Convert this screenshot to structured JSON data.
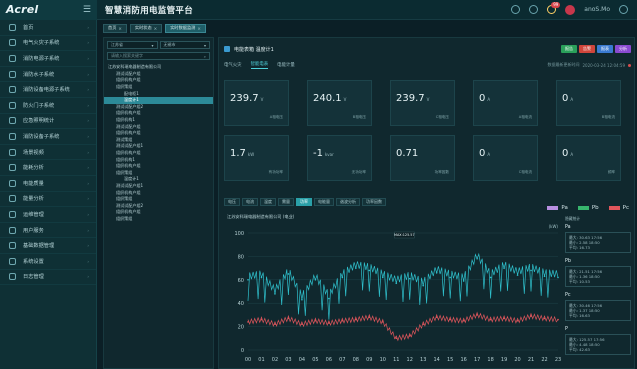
{
  "header": {
    "logo": "Acrel",
    "title": "智慧消防用电监管平台",
    "top_right_badge": "99",
    "user": "anoS.Mo"
  },
  "sidebar": {
    "items": [
      {
        "label": "首页"
      },
      {
        "label": "电气火灾子系统"
      },
      {
        "label": "消防电源子系统"
      },
      {
        "label": "消防水子系统"
      },
      {
        "label": "消防设备电源子系统"
      },
      {
        "label": "防火门子系统"
      },
      {
        "label": "应急照明统计"
      },
      {
        "label": "消防设备子系统"
      },
      {
        "label": "场景视频"
      },
      {
        "label": "能耗分析"
      },
      {
        "label": "电能质量"
      },
      {
        "label": "能量分析"
      },
      {
        "label": "运维管理"
      },
      {
        "label": "用户服务"
      },
      {
        "label": "基础数据管理"
      },
      {
        "label": "系统设置"
      },
      {
        "label": "日志管理"
      }
    ]
  },
  "tabs": [
    {
      "label": "首页",
      "active": false
    },
    {
      "label": "实时状态",
      "active": false
    },
    {
      "label": "实时数据监测",
      "active": true
    }
  ],
  "tree": {
    "select1": "江苏省",
    "select2": "无锡市",
    "input_placeholder": "请输入搜索关键字",
    "nodes": [
      {
        "label": "江苏安科瑞电器制造有限公司",
        "indent": 0
      },
      {
        "label": "测试试配户组",
        "indent": 1
      },
      {
        "label": "组织机构户组",
        "indent": 1
      },
      {
        "label": "组织策组",
        "indent": 1
      },
      {
        "label": "配电柜1",
        "indent": 2
      },
      {
        "label": "温度计1",
        "indent": 2,
        "selected": true
      },
      {
        "label": "测试试配户组2",
        "indent": 1
      },
      {
        "label": "组织机构户组",
        "indent": 1
      },
      {
        "label": "组织机构1",
        "indent": 1
      },
      {
        "label": "测试试配户组",
        "indent": 1
      },
      {
        "label": "组织机构户组",
        "indent": 1
      },
      {
        "label": "测试策组",
        "indent": 1
      },
      {
        "label": "测试试配户组1",
        "indent": 1
      },
      {
        "label": "组织机构户组",
        "indent": 1
      },
      {
        "label": "组织机构1",
        "indent": 1
      },
      {
        "label": "组织机构户组",
        "indent": 1
      },
      {
        "label": "组织策组",
        "indent": 1
      },
      {
        "label": "温度计1",
        "indent": 2
      },
      {
        "label": "测试试配户组1",
        "indent": 1
      },
      {
        "label": "组织机构户组",
        "indent": 1
      },
      {
        "label": "组织策组",
        "indent": 1
      },
      {
        "label": "测试试配户组2",
        "indent": 1
      },
      {
        "label": "组织机构户组",
        "indent": 1
      },
      {
        "label": "组织策组",
        "indent": 1
      }
    ]
  },
  "device": {
    "name": "电能表箱 温度计1",
    "actions": [
      {
        "label": "报告",
        "color": "#2aa05a"
      },
      {
        "label": "告警",
        "color": "#d0453b"
      },
      {
        "label": "报表",
        "color": "#3a7ad0"
      },
      {
        "label": "分析",
        "color": "#8a4ad0"
      }
    ],
    "subtabs": [
      {
        "label": "电气火灾",
        "active": false
      },
      {
        "label": "智能电表",
        "active": true
      },
      {
        "label": "电能计量",
        "active": false
      }
    ],
    "update_label": "数据最新更新时间",
    "update_time": "2020-03-24 12:04:59"
  },
  "cards": [
    {
      "value": "239.7",
      "unit": "V",
      "label": "A相电压"
    },
    {
      "value": "240.1",
      "unit": "V",
      "label": "B相电压"
    },
    {
      "value": "239.7",
      "unit": "V",
      "label": "C相电压"
    },
    {
      "value": "0",
      "unit": "A",
      "label": "A相电流"
    },
    {
      "value": "0",
      "unit": "A",
      "label": "B相电流"
    },
    {
      "value": "1.7",
      "unit": "kW",
      "label": "有功功率"
    },
    {
      "value": "-1",
      "unit": "kvar",
      "label": "无功功率"
    },
    {
      "value": "0.71",
      "unit": "",
      "label": "功率因数"
    },
    {
      "value": "0",
      "unit": "A",
      "label": "C相电流"
    },
    {
      "value": "0",
      "unit": "A",
      "label": "频率"
    }
  ],
  "chart_tabs": [
    {
      "label": "电压",
      "active": false
    },
    {
      "label": "电流",
      "active": false
    },
    {
      "label": "温度",
      "active": false
    },
    {
      "label": "需量",
      "active": false
    },
    {
      "label": "功率",
      "active": true
    },
    {
      "label": "电能量",
      "active": false
    },
    {
      "label": "谐波分析",
      "active": false
    },
    {
      "label": "功率因数",
      "active": false
    }
  ],
  "chart_data": {
    "type": "line",
    "title": "江苏安科瑞电器制造有限公司 (电业)",
    "ylabel": "(kW)",
    "ylim": [
      0,
      100
    ],
    "yticks": [
      0,
      20,
      40,
      60,
      80,
      100
    ],
    "x": [
      "00",
      "01",
      "02",
      "03",
      "04",
      "05",
      "06",
      "07",
      "08",
      "09",
      "10",
      "11",
      "12",
      "13",
      "14",
      "15",
      "16",
      "17",
      "18",
      "19",
      "20",
      "21",
      "22",
      "23"
    ],
    "series": [
      {
        "name": "Pa",
        "color": "#b78fe0",
        "values": []
      },
      {
        "name": "Pb",
        "color": "#37b66d",
        "values": []
      },
      {
        "name": "Pc",
        "color": "#e0565c",
        "values": []
      }
    ],
    "drawn": [
      {
        "color": "#2fc0cc",
        "values": [
          60,
          62,
          48,
          65,
          43,
          60,
          44,
          62,
          70,
          68,
          62,
          57,
          61,
          55,
          66,
          62,
          59,
          78,
          62,
          70,
          64,
          68,
          63,
          62
        ]
      },
      {
        "color": "#e0565c",
        "values": [
          24,
          26,
          22,
          27,
          22,
          25,
          23,
          25,
          26,
          28,
          24,
          10,
          12,
          22,
          28,
          26,
          25,
          30,
          26,
          27,
          25,
          29,
          27,
          26
        ]
      }
    ],
    "tooltip": "MAX:125.57",
    "legend": "top-right"
  },
  "stats": {
    "toggle": "隐藏统计",
    "groups": [
      {
        "name": "Pa",
        "rows": [
          "最大: 30.63 17:56",
          "最小: 2.58 18:50",
          "平均: 16.73"
        ]
      },
      {
        "name": "Pb",
        "rows": [
          "最大: 21.51 17:56",
          "最小: 1.36 18:50",
          "平均: 10.53"
        ]
      },
      {
        "name": "Pc",
        "rows": [
          "最大: 30.46 17:56",
          "最小: 1.37 18:50",
          "平均: 16.63"
        ]
      },
      {
        "name": "P",
        "rows": [
          "最大: 125.57 17:56",
          "最小: 4.48 18:50",
          "平均: 42.63"
        ]
      }
    ]
  }
}
